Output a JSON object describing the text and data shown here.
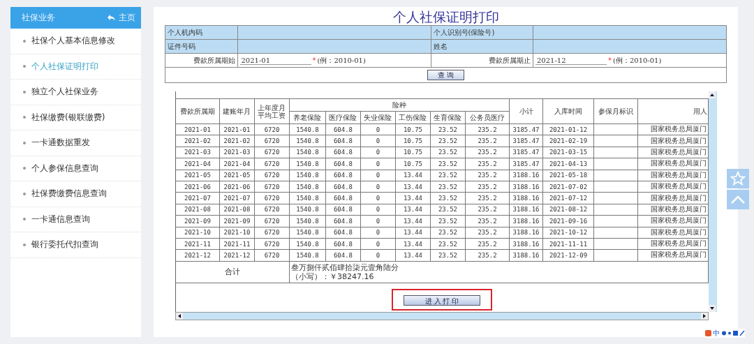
{
  "sidebar": {
    "title": "社保业务",
    "home_label": "主页",
    "items": [
      {
        "label": "社保个人基本信息修改",
        "selected": false
      },
      {
        "label": "个人社保证明打印",
        "selected": true
      },
      {
        "label": "独立个人社保业务",
        "selected": false
      },
      {
        "label": "社保缴费(银联缴费)",
        "selected": false
      },
      {
        "label": "一卡通数据重发",
        "selected": false
      },
      {
        "label": "个人参保信息查询",
        "selected": false
      },
      {
        "label": "社保费缴费信息查询",
        "selected": false
      },
      {
        "label": "一卡通信息查询",
        "selected": false
      },
      {
        "label": "银行委托代扣查询",
        "selected": false
      }
    ]
  },
  "page_title": "个人社保证明打印",
  "form": {
    "machine_code_label": "个人机内码",
    "id_number_label": "个人识别号(保险号)",
    "certificate_label": "证件号码",
    "name_label": "姓名",
    "start": {
      "label": "费款所属期始",
      "value": "2021-01",
      "required_mark": "*",
      "hint": "(例：2010-01)"
    },
    "end": {
      "label": "费款所属期止",
      "value": "2021-12",
      "required_mark": "*",
      "hint": "(例：2010-01)"
    },
    "query_button": "查 询"
  },
  "table": {
    "group_header": "险种",
    "columns": [
      {
        "label": "费款所属期",
        "in_group": false
      },
      {
        "label": "建账年月",
        "in_group": false
      },
      {
        "label": "上年度月平均工资",
        "in_group": false
      },
      {
        "label": "养老保险",
        "in_group": true
      },
      {
        "label": "医疗保险",
        "in_group": true
      },
      {
        "label": "失业保险",
        "in_group": true
      },
      {
        "label": "工伤保险",
        "in_group": true
      },
      {
        "label": "生育保险",
        "in_group": true
      },
      {
        "label": "公务员医疗",
        "in_group": true
      },
      {
        "label": "小计",
        "in_group": false
      },
      {
        "label": "入库时间",
        "in_group": false
      },
      {
        "label": "参保月标识",
        "in_group": false
      },
      {
        "label": "用人",
        "in_group": false
      }
    ],
    "rows": [
      [
        "2021-01",
        "2021-01",
        "6720",
        "1540.8",
        "604.8",
        "0",
        "10.75",
        "23.52",
        "235.2",
        "3185.47",
        "2021-01-12",
        "",
        "国家税务总局厦门"
      ],
      [
        "2021-02",
        "2021-02",
        "6720",
        "1540.8",
        "604.8",
        "0",
        "10.75",
        "23.52",
        "235.2",
        "3185.47",
        "2021-02-19",
        "",
        "国家税务总局厦门"
      ],
      [
        "2021-03",
        "2021-03",
        "6720",
        "1540.8",
        "604.8",
        "0",
        "10.75",
        "23.52",
        "235.2",
        "3185.47",
        "2021-03-15",
        "",
        "国家税务总局厦门"
      ],
      [
        "2021-04",
        "2021-04",
        "6720",
        "1540.8",
        "604.8",
        "0",
        "10.75",
        "23.52",
        "235.2",
        "3185.47",
        "2021-04-13",
        "",
        "国家税务总局厦门"
      ],
      [
        "2021-05",
        "2021-05",
        "6720",
        "1540.8",
        "604.8",
        "0",
        "13.44",
        "23.52",
        "235.2",
        "3188.16",
        "2021-05-18",
        "",
        "国家税务总局厦门"
      ],
      [
        "2021-06",
        "2021-06",
        "6720",
        "1540.8",
        "604.8",
        "0",
        "13.44",
        "23.52",
        "235.2",
        "3188.16",
        "2021-07-02",
        "",
        "国家税务总局厦门"
      ],
      [
        "2021-07",
        "2021-07",
        "6720",
        "1540.8",
        "604.8",
        "0",
        "13.44",
        "23.52",
        "235.2",
        "3188.16",
        "2021-07-12",
        "",
        "国家税务总局厦门"
      ],
      [
        "2021-08",
        "2021-08",
        "6720",
        "1540.8",
        "604.8",
        "0",
        "13.44",
        "23.52",
        "235.2",
        "3188.16",
        "2021-08-12",
        "",
        "国家税务总局厦门"
      ],
      [
        "2021-09",
        "2021-09",
        "6720",
        "1540.8",
        "604.8",
        "0",
        "13.44",
        "23.52",
        "235.2",
        "3188.16",
        "2021-09-16",
        "",
        "国家税务总局厦门"
      ],
      [
        "2021-10",
        "2021-10",
        "6720",
        "1540.8",
        "604.8",
        "0",
        "13.44",
        "23.52",
        "235.2",
        "3188.16",
        "2021-10-12",
        "",
        "国家税务总局厦门"
      ],
      [
        "2021-11",
        "2021-11",
        "6720",
        "1540.8",
        "604.8",
        "0",
        "13.44",
        "23.52",
        "235.2",
        "3188.16",
        "2021-11-11",
        "",
        "国家税务总局厦门"
      ],
      [
        "2021-12",
        "2021-12",
        "6720",
        "1540.8",
        "604.8",
        "0",
        "13.44",
        "23.52",
        "235.2",
        "3188.16",
        "2021-12-09",
        "",
        "国家税务总局厦门"
      ]
    ],
    "total": {
      "label": "合计",
      "amount_words": "叁万捌仟贰佰肆拾柒元壹角陆分",
      "amount_figures": "（小写）：￥38247.16"
    }
  },
  "print_button": {
    "label": "进 入 打 印",
    "highlighted": true
  },
  "ime_toolbar": {
    "label": "中"
  }
}
